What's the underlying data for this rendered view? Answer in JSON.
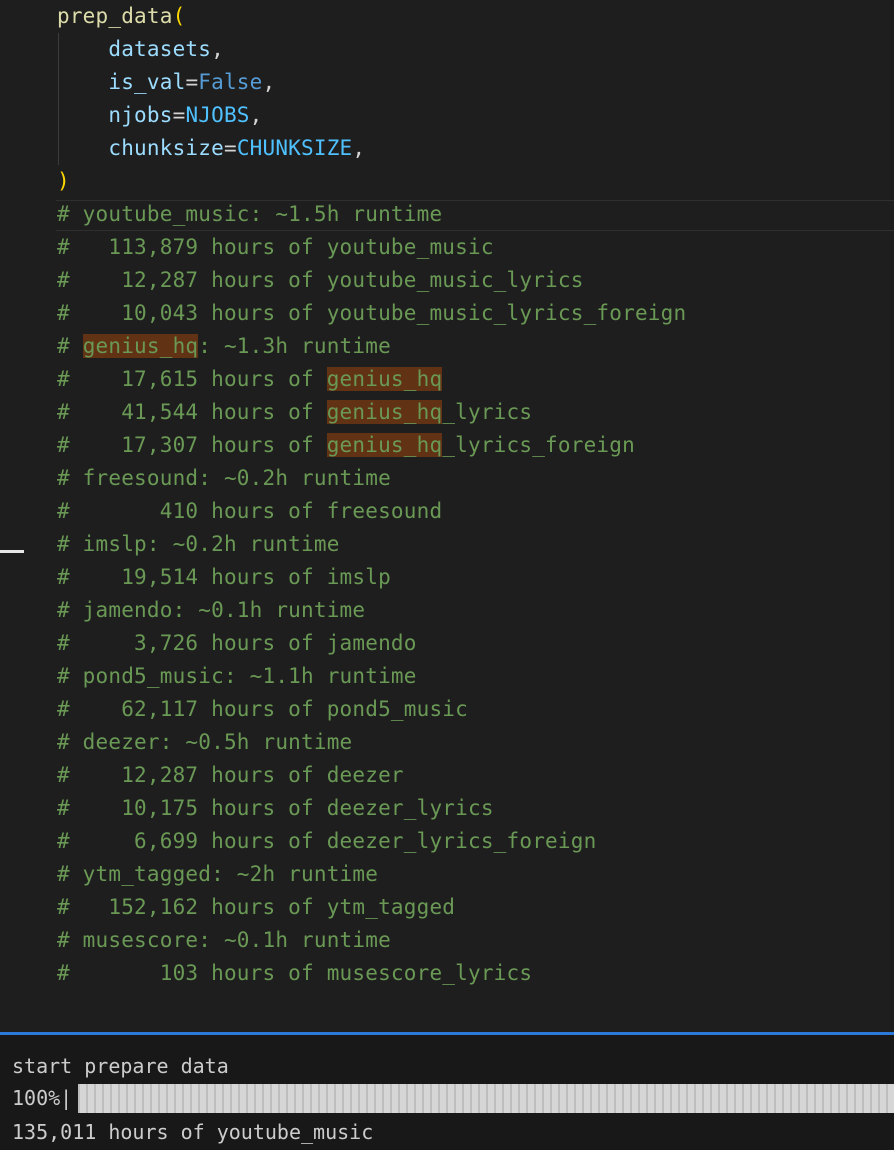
{
  "editor": {
    "lines": [
      [
        {
          "t": "prep_data",
          "c": "tok-fn"
        },
        {
          "t": "(",
          "c": "tok-paren"
        }
      ],
      [
        {
          "t": "    datasets",
          "c": "tok-var"
        },
        {
          "t": ",",
          "c": "tok-op"
        }
      ],
      [
        {
          "t": "    is_val",
          "c": "tok-var"
        },
        {
          "t": "=",
          "c": "tok-op"
        },
        {
          "t": "False",
          "c": "tok-kw"
        },
        {
          "t": ",",
          "c": "tok-op"
        }
      ],
      [
        {
          "t": "    njobs",
          "c": "tok-var"
        },
        {
          "t": "=",
          "c": "tok-op"
        },
        {
          "t": "NJOBS",
          "c": "tok-const"
        },
        {
          "t": ",",
          "c": "tok-op"
        }
      ],
      [
        {
          "t": "    chunksize",
          "c": "tok-var"
        },
        {
          "t": "=",
          "c": "tok-op"
        },
        {
          "t": "CHUNKSIZE",
          "c": "tok-const"
        },
        {
          "t": ",",
          "c": "tok-op"
        }
      ],
      [
        {
          "t": ")",
          "c": "tok-paren"
        }
      ],
      [
        {
          "t": "# youtube_music: ~1.5h runtime",
          "c": "tok-comment"
        }
      ],
      [
        {
          "t": "#   113,879 hours of youtube_music",
          "c": "tok-comment"
        }
      ],
      [
        {
          "t": "#    12,287 hours of youtube_music_lyrics",
          "c": "tok-comment"
        }
      ],
      [
        {
          "t": "#    10,043 hours of youtube_music_lyrics_foreign",
          "c": "tok-comment"
        }
      ],
      [
        {
          "t": "# ",
          "c": "tok-comment"
        },
        {
          "t": "genius_hq",
          "c": "tok-comment hl"
        },
        {
          "t": ": ~1.3h runtime",
          "c": "tok-comment"
        }
      ],
      [
        {
          "t": "#    17,615 hours of ",
          "c": "tok-comment"
        },
        {
          "t": "genius_hq",
          "c": "tok-comment hl"
        }
      ],
      [
        {
          "t": "#    41,544 hours of ",
          "c": "tok-comment"
        },
        {
          "t": "genius_hq",
          "c": "tok-comment hl"
        },
        {
          "t": "_lyrics",
          "c": "tok-comment"
        }
      ],
      [
        {
          "t": "#    17,307 hours of ",
          "c": "tok-comment"
        },
        {
          "t": "genius_hq",
          "c": "tok-comment hl"
        },
        {
          "t": "_lyrics_foreign",
          "c": "tok-comment"
        }
      ],
      [
        {
          "t": "# freesound: ~0.2h runtime",
          "c": "tok-comment"
        }
      ],
      [
        {
          "t": "#       410 hours of freesound",
          "c": "tok-comment"
        }
      ],
      [
        {
          "t": "# imslp: ~0.2h runtime",
          "c": "tok-comment"
        }
      ],
      [
        {
          "t": "#    19,514 hours of imslp",
          "c": "tok-comment"
        }
      ],
      [
        {
          "t": "# jamendo: ~0.1h runtime",
          "c": "tok-comment"
        }
      ],
      [
        {
          "t": "#     3,726 hours of jamendo",
          "c": "tok-comment"
        }
      ],
      [
        {
          "t": "# pond5_music: ~1.1h runtime",
          "c": "tok-comment"
        }
      ],
      [
        {
          "t": "#    62,117 hours of pond5_music",
          "c": "tok-comment"
        }
      ],
      [
        {
          "t": "# deezer: ~0.5h runtime",
          "c": "tok-comment"
        }
      ],
      [
        {
          "t": "#    12,287 hours of deezer",
          "c": "tok-comment"
        }
      ],
      [
        {
          "t": "#    10,175 hours of deezer_lyrics",
          "c": "tok-comment"
        }
      ],
      [
        {
          "t": "#     6,699 hours of deezer_lyrics_foreign",
          "c": "tok-comment"
        }
      ],
      [
        {
          "t": "# ytm_tagged: ~2h runtime",
          "c": "tok-comment"
        }
      ],
      [
        {
          "t": "#   152,162 hours of ytm_tagged",
          "c": "tok-comment"
        }
      ],
      [
        {
          "t": "# musescore: ~0.1h runtime",
          "c": "tok-comment"
        }
      ],
      [
        {
          "t": "#       103 hours of musescore_lyrics",
          "c": "tok-comment"
        }
      ]
    ]
  },
  "terminal": {
    "line1": "start prepare data",
    "progress_label": "100%|",
    "progress_fraction": 1.0,
    "line3": "135,011 hours of youtube_music"
  }
}
